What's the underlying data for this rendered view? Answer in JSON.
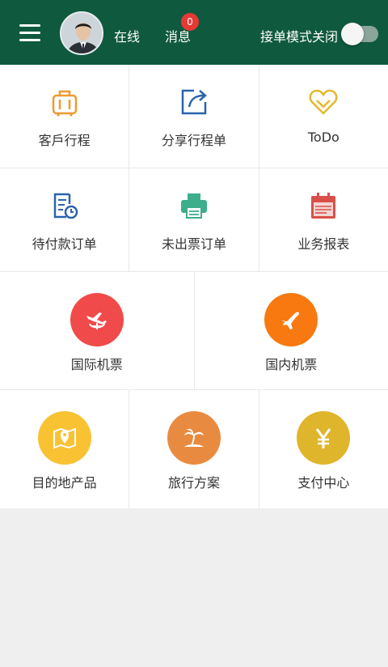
{
  "header": {
    "status": "在线",
    "messages_label": "消息",
    "messages_count": "0",
    "mode_label": "接单模式关闭",
    "mode_on": false
  },
  "grid": {
    "row1": [
      "客戶行程",
      "分享行程单",
      "ToDo"
    ],
    "row2": [
      "待付款订单",
      "未出票订单",
      "业务报表"
    ],
    "row3": [
      "国际机票",
      "国内机票"
    ],
    "row4": [
      "目的地产品",
      "旅行方案",
      "支付中心"
    ]
  },
  "colors": {
    "header": "#0f5a3e",
    "intl_flight": "#f04a4a",
    "domestic_flight": "#f7790f",
    "destination": "#f8c233",
    "travel_plan": "#e88b41",
    "payment": "#dfb52b"
  }
}
